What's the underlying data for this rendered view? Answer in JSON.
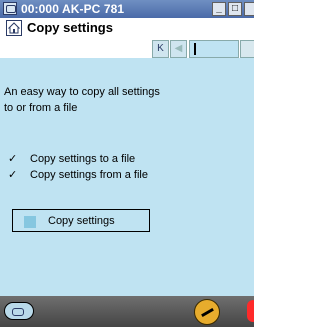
{
  "window": {
    "title": "00:000 AK-PC 781",
    "controls": {
      "minimize": "_",
      "maximize": "□"
    }
  },
  "header": {
    "title": "Copy settings"
  },
  "description": {
    "line1": "An easy way to copy all settings",
    "line2": "to or from a file"
  },
  "options": [
    {
      "check": "✓",
      "label": "Copy settings to a file"
    },
    {
      "check": "✓",
      "label": "Copy settings from a file"
    }
  ],
  "copy_settings": {
    "label": "Copy settings"
  },
  "navigation": {
    "first_symbol": "K",
    "prev_symbol": "◀"
  },
  "colors": {
    "background": "#bfe3f2",
    "titlebar": "#4a6aa8",
    "accent": "#86c7e0",
    "bottom_bar": "#454545",
    "key_button": "#e7ac2d",
    "alert": "#ff2a2a"
  },
  "icons": {
    "app": "app-icon",
    "home": "home-icon",
    "bottom_left": "service-icon",
    "bottom_middle": "key-icon"
  }
}
